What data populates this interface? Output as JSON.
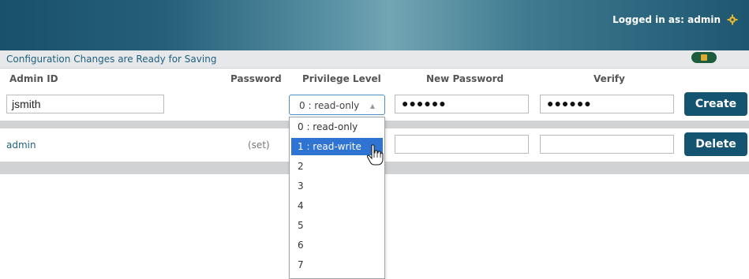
{
  "header": {
    "logged_in_text": "Logged in as: admin"
  },
  "status_bar": {
    "message": "Configuration Changes are Ready for Saving"
  },
  "columns": {
    "admin_id": "Admin ID",
    "password": "Password",
    "privilege_level": "Privilege Level",
    "new_password": "New Password",
    "verify": "Verify"
  },
  "new_user": {
    "admin_id_value": "jsmith",
    "privilege_selected": "0 : read-only",
    "new_password_masked": "●●●●●●",
    "verify_masked": "●●●●●●",
    "create_label": "Create"
  },
  "existing_user": {
    "admin_id": "admin",
    "password_status": "(set)",
    "delete_label": "Delete"
  },
  "privilege_options": [
    "0 : read-only",
    "1 : read-write",
    "2",
    "3",
    "4",
    "5",
    "6",
    "7"
  ],
  "highlighted_option_index": 1,
  "colors": {
    "header_accent": "#1f5a74",
    "button_bg": "#155470",
    "selected_option": "#2f73d3"
  },
  "icons": {
    "settings": "gear-icon",
    "save": "save-icon",
    "cursor": "hand-cursor-icon"
  }
}
